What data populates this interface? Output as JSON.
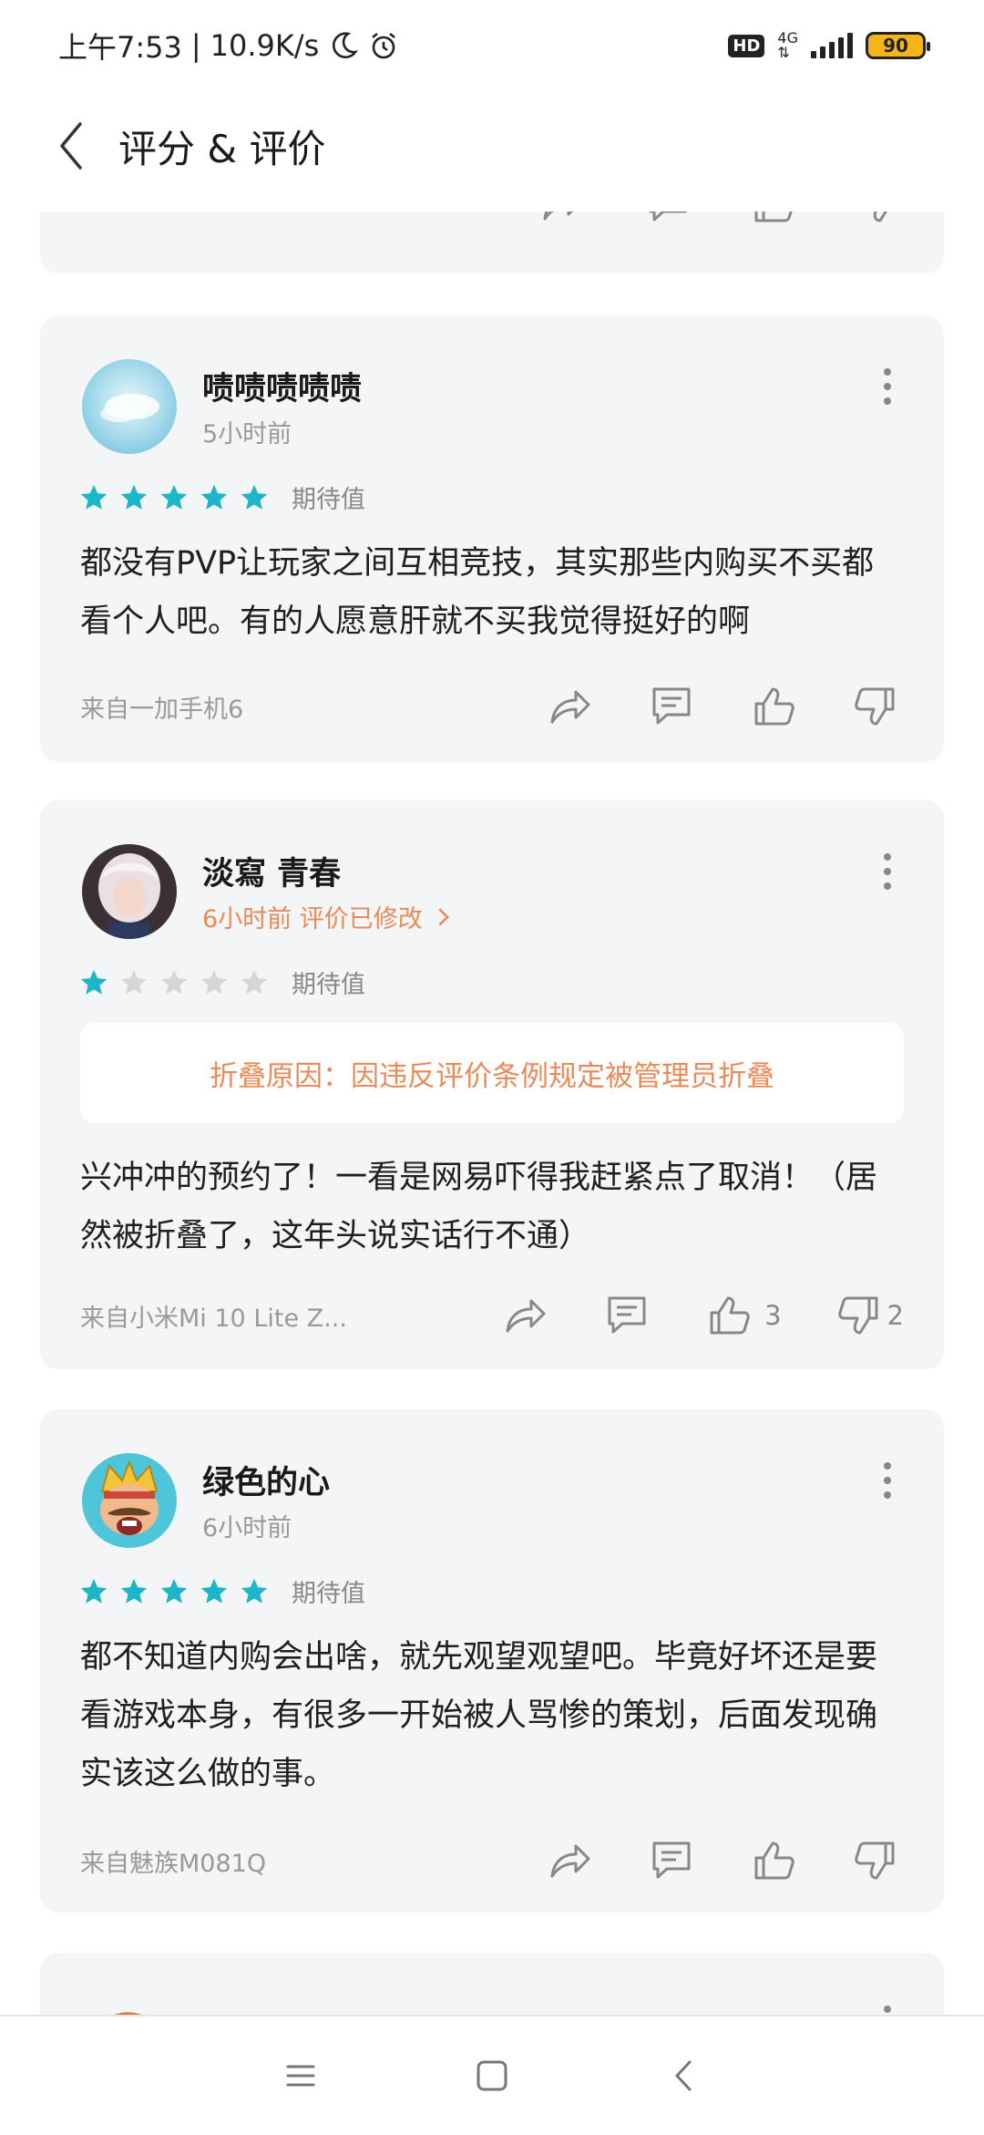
{
  "status_bar": {
    "time": "上午7:53",
    "separator": "|",
    "speed": "10.9K/s",
    "hd": "HD",
    "network": "4G",
    "battery": "90",
    "battery_color": "#f3b51a"
  },
  "header": {
    "title": "评分 & 评价"
  },
  "colors": {
    "star_filled": "#1bb6c7",
    "star_empty": "#d6d6d6",
    "accent_orange": "#e98b58"
  },
  "rating_label": "期待值",
  "reviews": [
    {
      "username": "啧啧啧啧啧",
      "time": "5小时前",
      "stars": 5,
      "text": "都没有PVP让玩家之间互相竞技，其实那些内购买不买都看个人吧。有的人愿意肝就不买我觉得挺好的啊",
      "device": "来自一加手机6"
    },
    {
      "username": "淡寫 青春",
      "time": "6小时前 评价已修改",
      "stars": 1,
      "fold_notice": "折叠原因：因违反评价条例规定被管理员折叠",
      "text": "兴冲冲的预约了！一看是网易吓得我赶紧点了取消！（居然被折叠了，这年头说实话行不通）",
      "device": "来自小米Mi 10 Lite Z...",
      "like_count": "3",
      "dislike_count": "2"
    },
    {
      "username": "绿色的心",
      "time": "6小时前",
      "stars": 5,
      "text": "都不知道内购会出啥，就先观望观望吧。毕竟好坏还是要看游戏本身，有很多一开始被人骂惨的策划，后面发现确实该这么做的事。",
      "device": "来自魅族M081Q"
    }
  ]
}
